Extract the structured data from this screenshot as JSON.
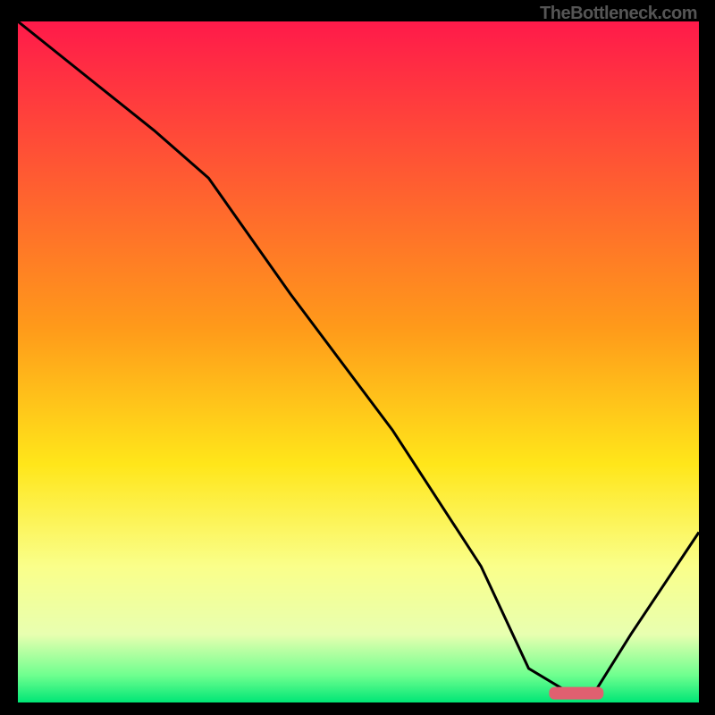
{
  "watermark": "TheBottleneck.com",
  "chart_data": {
    "type": "line",
    "xlim": [
      0,
      100
    ],
    "ylim": [
      0,
      100
    ],
    "gradient_stops": [
      {
        "offset": 0,
        "color": "#ff1a4a"
      },
      {
        "offset": 45,
        "color": "#ff9a1a"
      },
      {
        "offset": 65,
        "color": "#ffe61a"
      },
      {
        "offset": 80,
        "color": "#faff8a"
      },
      {
        "offset": 90,
        "color": "#e8ffb0"
      },
      {
        "offset": 96,
        "color": "#6fff8f"
      },
      {
        "offset": 100,
        "color": "#00e676"
      }
    ],
    "curve": {
      "x": [
        0,
        10,
        20,
        28,
        40,
        55,
        68,
        75,
        80,
        85,
        90,
        100
      ],
      "values": [
        100,
        92,
        84,
        77,
        60,
        40,
        20,
        5,
        2,
        2,
        10,
        25
      ]
    },
    "marker": {
      "x_start": 78,
      "x_end": 86,
      "y": 1.5,
      "color": "#e06070"
    }
  }
}
